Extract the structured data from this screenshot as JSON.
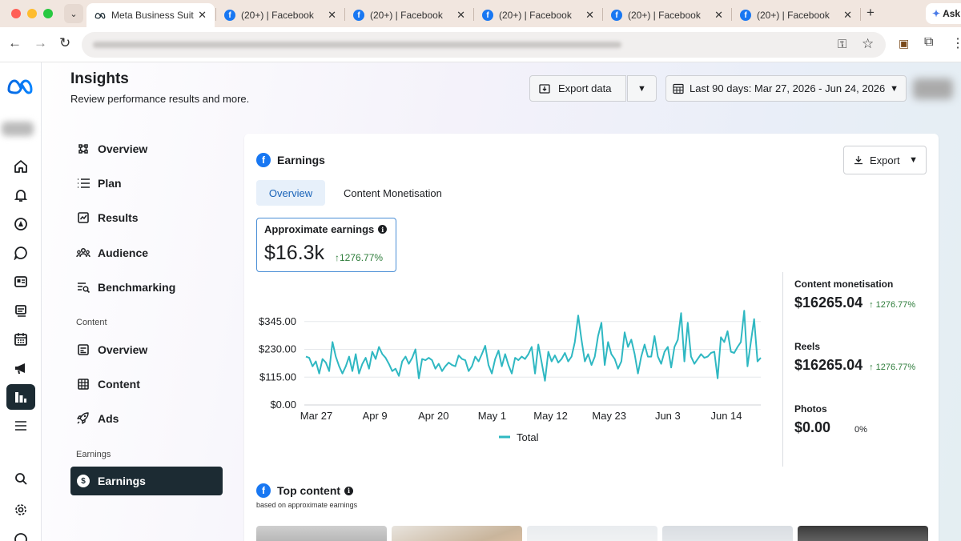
{
  "browser": {
    "tabs": [
      {
        "title": "Meta Business Suit",
        "active": true
      },
      {
        "title": "(20+) | Facebook",
        "active": false
      },
      {
        "title": "(20+) | Facebook",
        "active": false
      },
      {
        "title": "(20+) | Facebook",
        "active": false
      },
      {
        "title": "(20+) | Facebook",
        "active": false
      },
      {
        "title": "(20+) | Facebook",
        "active": false
      }
    ],
    "gemini_label": "Ask"
  },
  "header": {
    "title": "Insights",
    "subtitle": "Review performance results and more.",
    "export_data_label": "Export data",
    "date_range_label": "Last 90 days: Mar 27, 2026 - Jun 24, 2026"
  },
  "nav": {
    "items": [
      {
        "label": "Overview",
        "icon": "overview-icon"
      },
      {
        "label": "Plan",
        "icon": "list-icon"
      },
      {
        "label": "Results",
        "icon": "results-icon"
      },
      {
        "label": "Audience",
        "icon": "audience-icon"
      },
      {
        "label": "Benchmarking",
        "icon": "benchmark-icon"
      }
    ],
    "content_group_label": "Content",
    "content_items": [
      {
        "label": "Overview",
        "icon": "content-overview-icon"
      },
      {
        "label": "Content",
        "icon": "grid-icon"
      },
      {
        "label": "Ads",
        "icon": "rocket-icon"
      }
    ],
    "earnings_group_label": "Earnings",
    "earnings_item": {
      "label": "Earnings",
      "icon": "dollar-icon"
    }
  },
  "card": {
    "title": "Earnings",
    "export_label": "Export",
    "tabs": [
      "Overview",
      "Content Monetisation"
    ],
    "metric": {
      "label": "Approximate earnings",
      "value": "$16.3k",
      "delta": "↑1276.77%"
    },
    "breakdown": [
      {
        "label": "Content monetisation",
        "value": "$16265.04",
        "delta": "↑ 1276.77%"
      },
      {
        "label": "Reels",
        "value": "$16265.04",
        "delta": "↑ 1276.77%"
      },
      {
        "label": "Photos",
        "value": "$0.00",
        "delta": "0%"
      }
    ],
    "top_content_title": "Top content",
    "top_content_subtitle": "based on approximate earnings"
  },
  "colors": {
    "accent": "#1877f2",
    "series": "#2fb8c2",
    "positive": "#2e7d3b",
    "selected_nav": "#1c2b33"
  },
  "chart_data": {
    "type": "line",
    "title": "",
    "xlabel": "",
    "ylabel": "",
    "ylim": [
      0,
      460
    ],
    "yticks": [
      "$345.00",
      "$230.00",
      "$115.00",
      "$0.00"
    ],
    "ytick_values": [
      345,
      230,
      115,
      0
    ],
    "xticks": [
      "Mar 27",
      "Apr 9",
      "Apr 20",
      "May 1",
      "May 12",
      "May 23",
      "Jun 3",
      "Jun 14"
    ],
    "legend": "bottom",
    "series": [
      {
        "name": "Total",
        "values": [
          200,
          195,
          160,
          180,
          130,
          190,
          175,
          140,
          260,
          200,
          160,
          130,
          160,
          200,
          140,
          210,
          130,
          170,
          195,
          150,
          220,
          190,
          240,
          210,
          195,
          170,
          140,
          150,
          120,
          180,
          200,
          170,
          195,
          230,
          110,
          190,
          185,
          195,
          185,
          150,
          170,
          140,
          160,
          175,
          165,
          160,
          205,
          190,
          185,
          140,
          160,
          200,
          180,
          210,
          245,
          165,
          130,
          190,
          225,
          160,
          210,
          165,
          130,
          195,
          185,
          200,
          190,
          210,
          240,
          130,
          250,
          175,
          100,
          220,
          180,
          205,
          175,
          190,
          215,
          180,
          200,
          260,
          370,
          270,
          180,
          210,
          165,
          200,
          285,
          340,
          165,
          260,
          210,
          190,
          150,
          180,
          300,
          240,
          270,
          210,
          130,
          200,
          250,
          200,
          200,
          285,
          200,
          170,
          220,
          240,
          155,
          240,
          270,
          380,
          180,
          340,
          200,
          170,
          190,
          210,
          195,
          200,
          215,
          220,
          110,
          280,
          260,
          305,
          220,
          215,
          240,
          260,
          390,
          160,
          260,
          355,
          180,
          195
        ]
      }
    ]
  }
}
